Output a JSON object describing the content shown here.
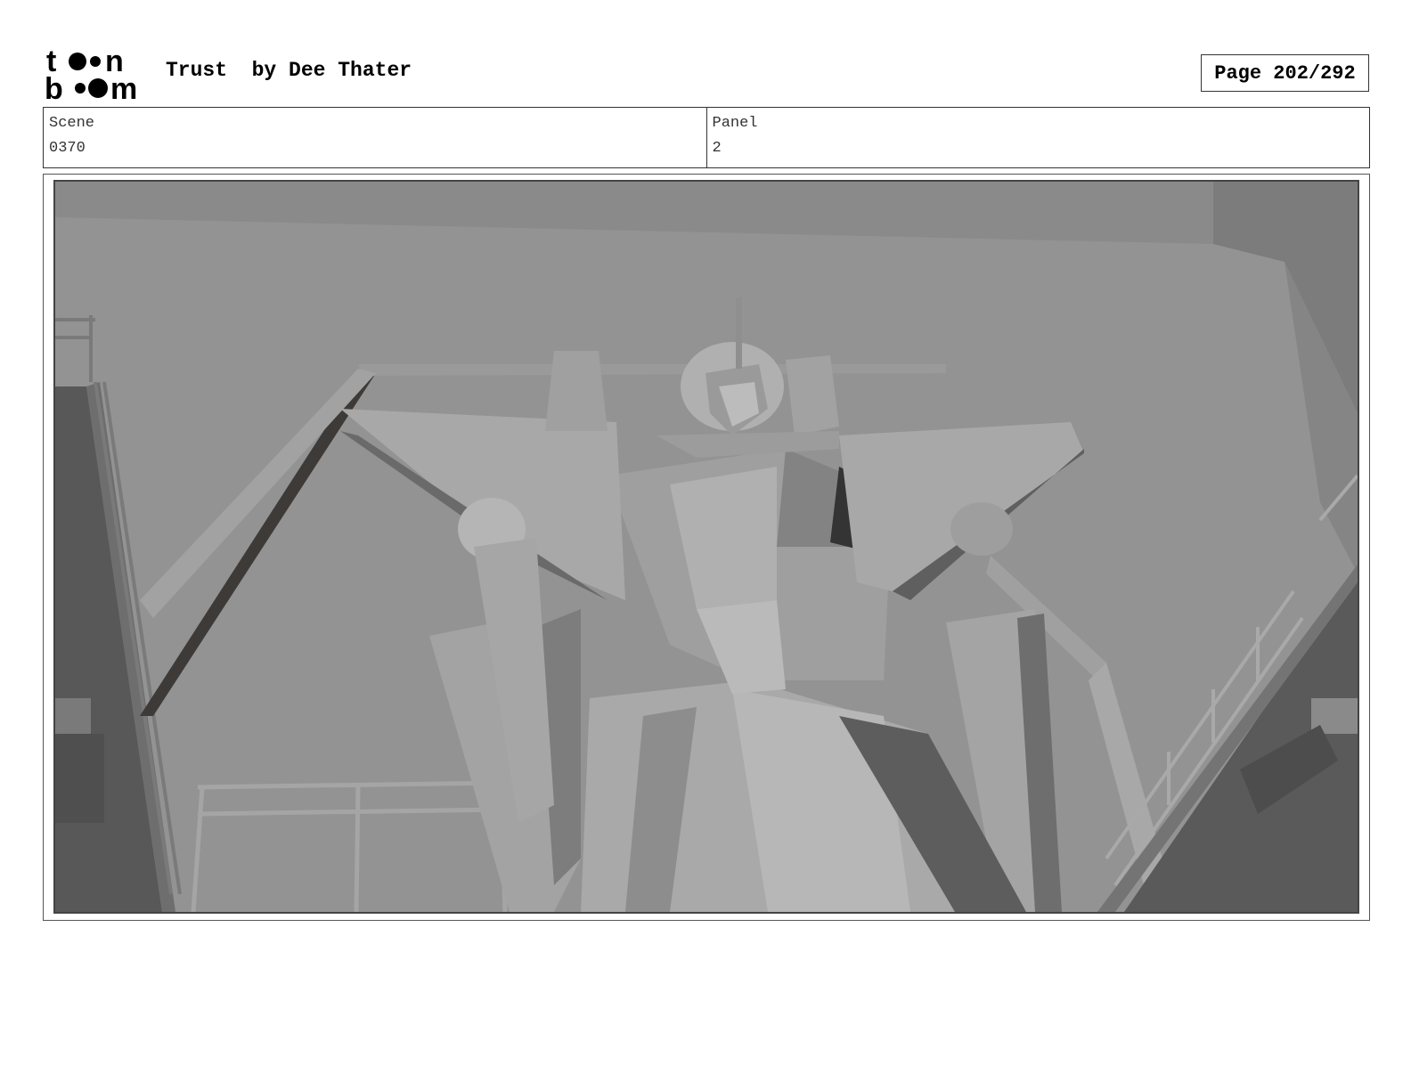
{
  "header": {
    "logo_text": "toonboom",
    "title": "Trust  by Dee Thater",
    "page_label": "Page 202/292"
  },
  "info": {
    "scene_label": "Scene",
    "scene_value": "0370",
    "panel_label": "Panel",
    "panel_value": "2"
  },
  "panel": {
    "image_subject": "giant-robot-in-hangar",
    "colors": {
      "background": "#8f8f8f",
      "dark": "#4a4a4a",
      "light": "#b5b5b5"
    }
  }
}
